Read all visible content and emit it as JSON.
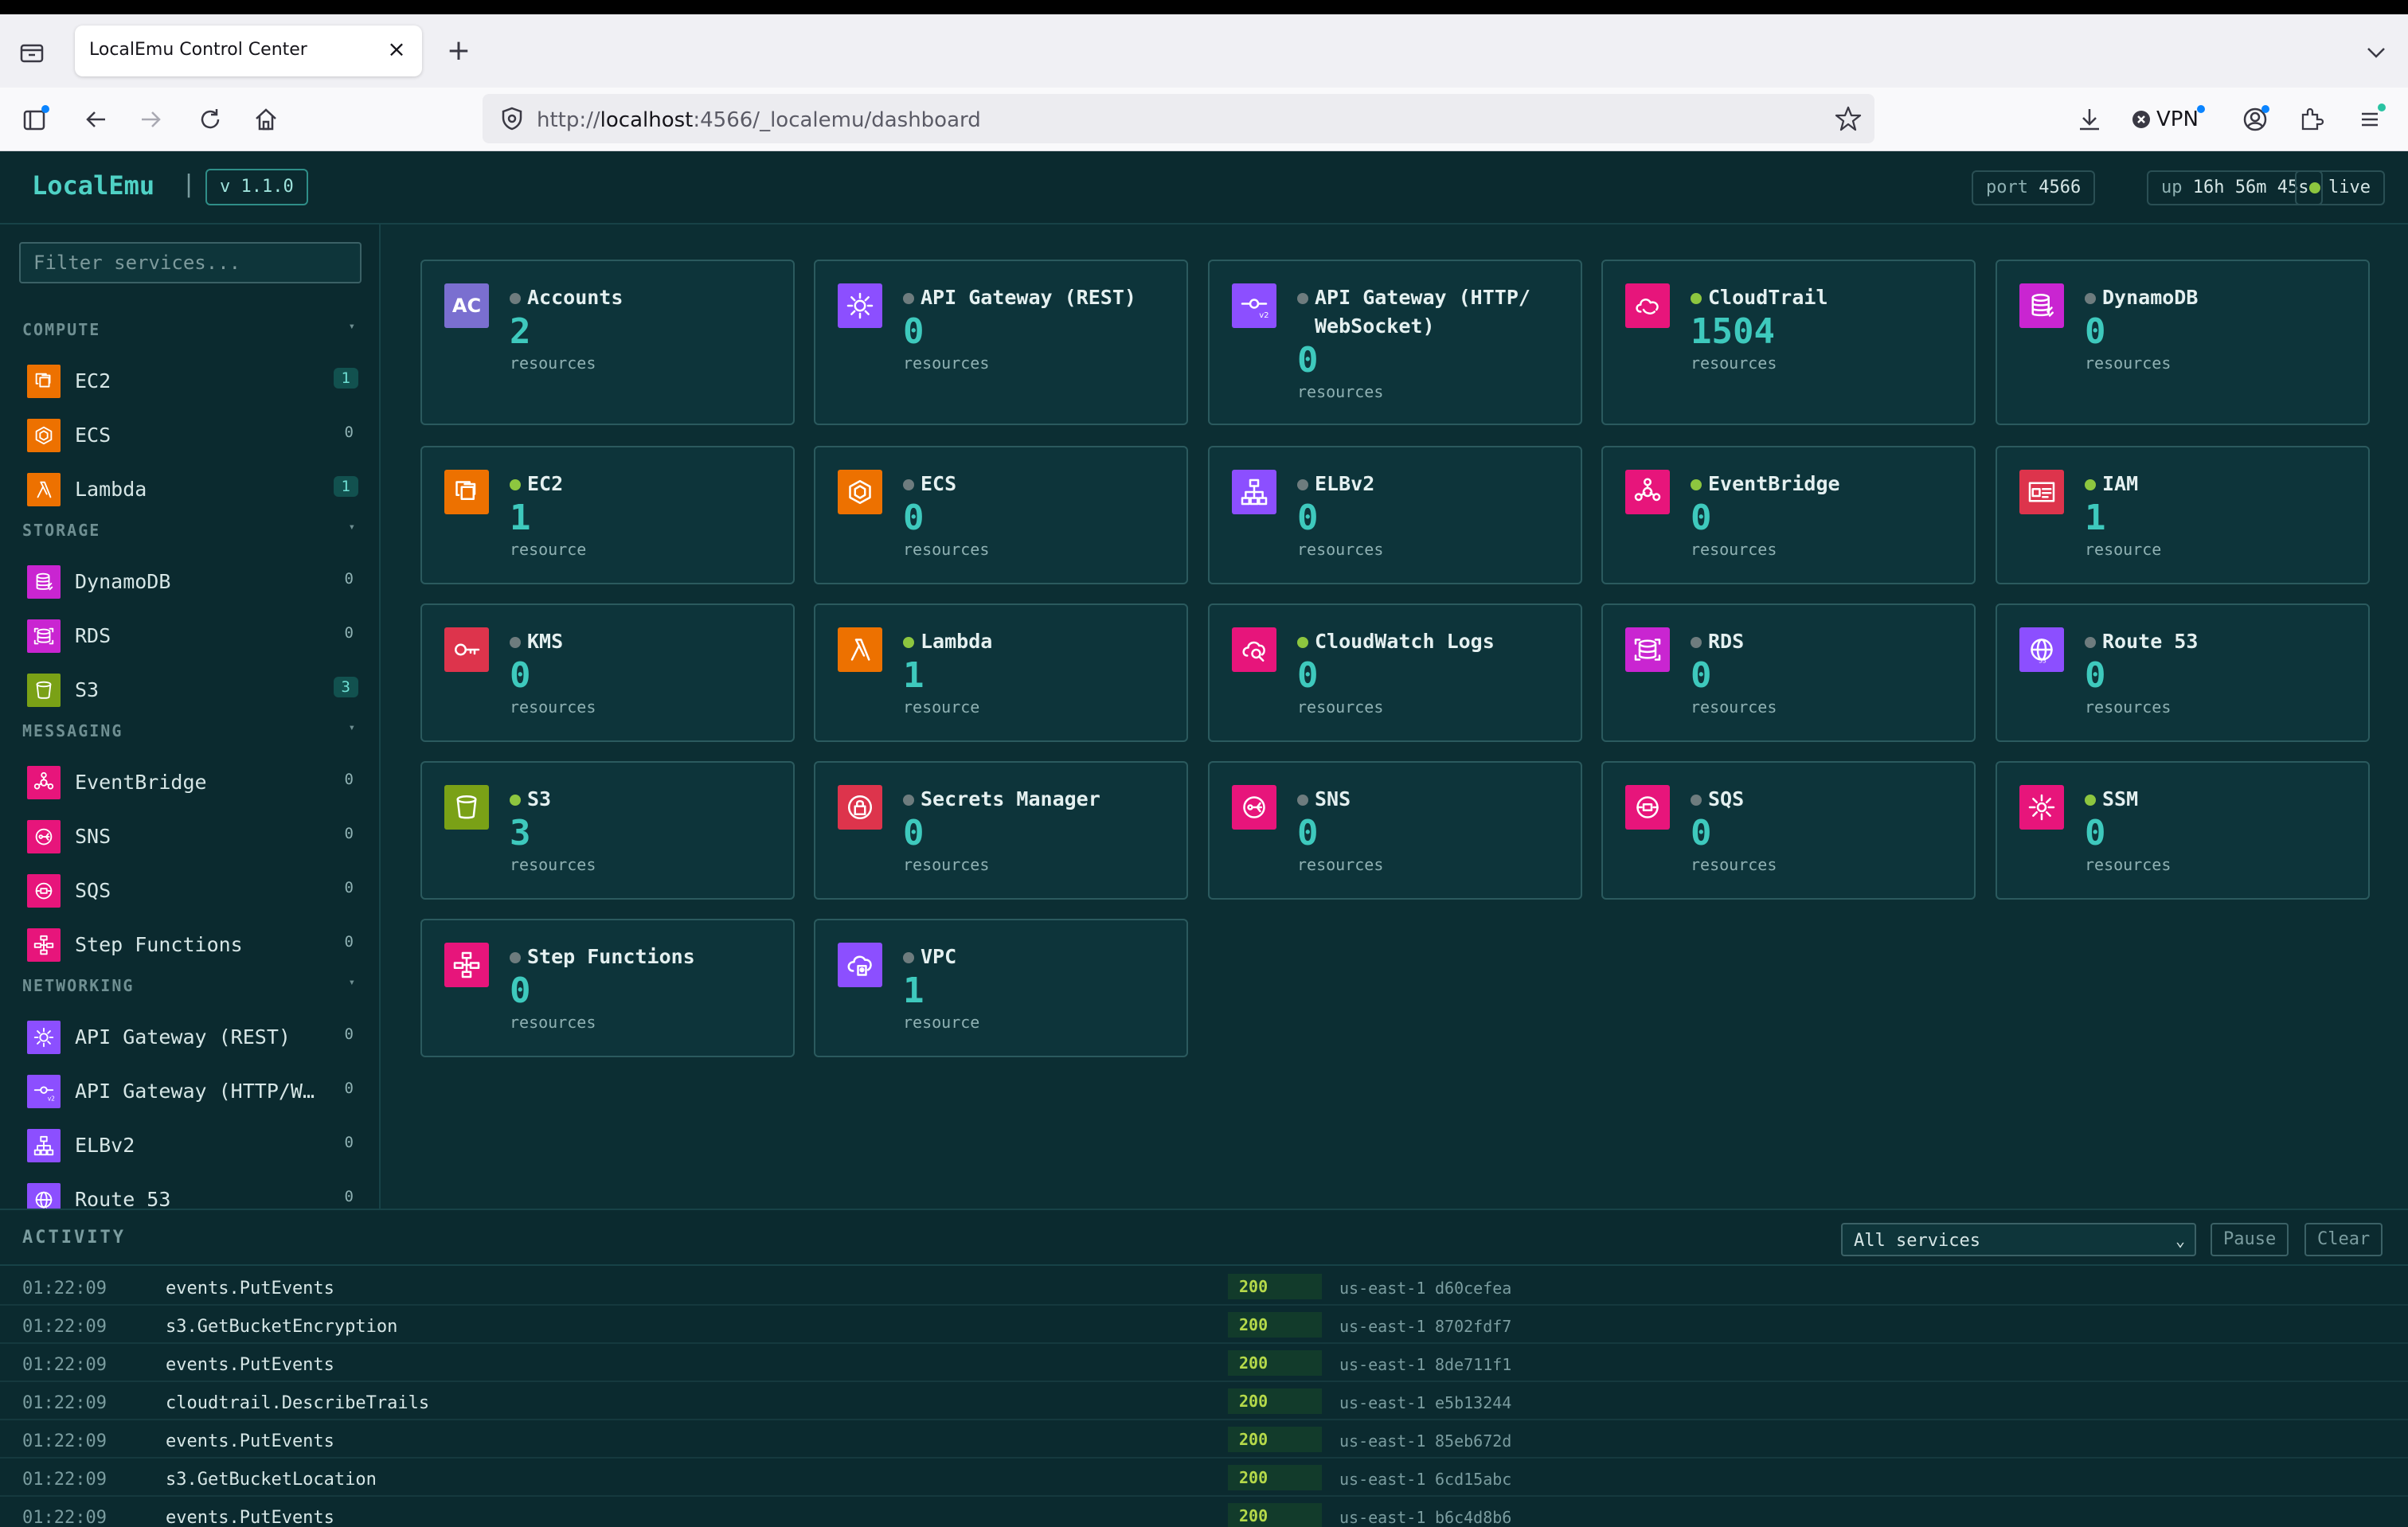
{
  "browser": {
    "tab_title": "LocalEmu Control Center",
    "url_prefix": "http://",
    "url_host": "localhost",
    "url_rest": ":4566/_localemu/dashboard",
    "vpn_label": "VPN"
  },
  "header": {
    "brand": "LocalEmu",
    "separator": "|",
    "version": "v 1.1.0",
    "port_label": "port",
    "port_value": "4566",
    "uptime_label": "up",
    "uptime_value": "16h 56m 45s",
    "status": "live"
  },
  "sidebar": {
    "filter_placeholder": "Filter services...",
    "groups": [
      {
        "title": "COMPUTE",
        "items": [
          {
            "label": "EC2",
            "count": "1"
          },
          {
            "label": "ECS",
            "count": "0"
          },
          {
            "label": "Lambda",
            "count": "1"
          }
        ]
      },
      {
        "title": "STORAGE",
        "items": [
          {
            "label": "DynamoDB",
            "count": "0"
          },
          {
            "label": "RDS",
            "count": "0"
          },
          {
            "label": "S3",
            "count": "3"
          }
        ]
      },
      {
        "title": "MESSAGING",
        "items": [
          {
            "label": "EventBridge",
            "count": "0"
          },
          {
            "label": "SNS",
            "count": "0"
          },
          {
            "label": "SQS",
            "count": "0"
          },
          {
            "label": "Step Functions",
            "count": "0"
          }
        ]
      },
      {
        "title": "NETWORKING",
        "items": [
          {
            "label": "API Gateway (REST)",
            "count": "0"
          },
          {
            "label": "API Gateway (HTTP/W…",
            "count": "0"
          },
          {
            "label": "ELBv2",
            "count": "0"
          },
          {
            "label": "Route 53",
            "count": "0"
          }
        ]
      }
    ]
  },
  "cards": [
    {
      "name": "Accounts",
      "count": "2",
      "unit": "resources",
      "active": false,
      "icon": "AC",
      "color": "#7a6fd0"
    },
    {
      "name": "API Gateway (REST)",
      "count": "0",
      "unit": "resources",
      "active": false,
      "icon": "apigw-icon",
      "color": "#8c4fff"
    },
    {
      "name": "API Gateway (HTTP/ WebSocket)",
      "count": "0",
      "unit": "resources",
      "active": false,
      "icon": "apigw-v2-icon",
      "color": "#8c4fff"
    },
    {
      "name": "CloudTrail",
      "count": "1504",
      "unit": "resources",
      "active": true,
      "icon": "cloudtrail-icon",
      "color": "#e7157b"
    },
    {
      "name": "DynamoDB",
      "count": "0",
      "unit": "resources",
      "active": false,
      "icon": "dynamodb-icon",
      "color": "#c925d1"
    },
    {
      "name": "EC2",
      "count": "1",
      "unit": "resource",
      "active": true,
      "icon": "ec2-icon",
      "color": "#ed7100"
    },
    {
      "name": "ECS",
      "count": "0",
      "unit": "resources",
      "active": false,
      "icon": "ecs-icon",
      "color": "#ed7100"
    },
    {
      "name": "ELBv2",
      "count": "0",
      "unit": "resources",
      "active": false,
      "icon": "elb-icon",
      "color": "#8c4fff"
    },
    {
      "name": "EventBridge",
      "count": "0",
      "unit": "resources",
      "active": true,
      "icon": "eventbridge-icon",
      "color": "#e7157b"
    },
    {
      "name": "IAM",
      "count": "1",
      "unit": "resource",
      "active": true,
      "icon": "iam-icon",
      "color": "#dd344c"
    },
    {
      "name": "KMS",
      "count": "0",
      "unit": "resources",
      "active": false,
      "icon": "kms-icon",
      "color": "#dd344c"
    },
    {
      "name": "Lambda",
      "count": "1",
      "unit": "resource",
      "active": true,
      "icon": "lambda-icon",
      "color": "#ed7100"
    },
    {
      "name": "CloudWatch Logs",
      "count": "0",
      "unit": "resources",
      "active": true,
      "icon": "cloudwatch-icon",
      "color": "#e7157b"
    },
    {
      "name": "RDS",
      "count": "0",
      "unit": "resources",
      "active": false,
      "icon": "rds-icon",
      "color": "#c925d1"
    },
    {
      "name": "Route 53",
      "count": "0",
      "unit": "resources",
      "active": false,
      "icon": "route53-icon",
      "color": "#8c4fff"
    },
    {
      "name": "S3",
      "count": "3",
      "unit": "resources",
      "active": true,
      "icon": "s3-icon",
      "color": "#7aa116"
    },
    {
      "name": "Secrets Manager",
      "count": "0",
      "unit": "resources",
      "active": false,
      "icon": "secrets-icon",
      "color": "#dd344c"
    },
    {
      "name": "SNS",
      "count": "0",
      "unit": "resources",
      "active": false,
      "icon": "sns-icon",
      "color": "#e7157b"
    },
    {
      "name": "SQS",
      "count": "0",
      "unit": "resources",
      "active": false,
      "icon": "sqs-icon",
      "color": "#e7157b"
    },
    {
      "name": "SSM",
      "count": "0",
      "unit": "resources",
      "active": true,
      "icon": "ssm-icon",
      "color": "#e7157b"
    },
    {
      "name": "Step Functions",
      "count": "0",
      "unit": "resources",
      "active": false,
      "icon": "stepfunctions-icon",
      "color": "#e7157b"
    },
    {
      "name": "VPC",
      "count": "1",
      "unit": "resource",
      "active": false,
      "icon": "vpc-icon",
      "color": "#8c4fff"
    }
  ],
  "activity": {
    "title": "ACTIVITY",
    "filter_value": "All services",
    "pause_label": "Pause",
    "clear_label": "Clear",
    "rows": [
      {
        "time": "01:22:09",
        "op": "events.PutEvents",
        "status": "200",
        "region": "us-east-1",
        "id": "d60cefea"
      },
      {
        "time": "01:22:09",
        "op": "s3.GetBucketEncryption",
        "status": "200",
        "region": "us-east-1",
        "id": "8702fdf7"
      },
      {
        "time": "01:22:09",
        "op": "events.PutEvents",
        "status": "200",
        "region": "us-east-1",
        "id": "8de711f1"
      },
      {
        "time": "01:22:09",
        "op": "cloudtrail.DescribeTrails",
        "status": "200",
        "region": "us-east-1",
        "id": "e5b13244"
      },
      {
        "time": "01:22:09",
        "op": "events.PutEvents",
        "status": "200",
        "region": "us-east-1",
        "id": "85eb672d"
      },
      {
        "time": "01:22:09",
        "op": "s3.GetBucketLocation",
        "status": "200",
        "region": "us-east-1",
        "id": "6cd15abc"
      },
      {
        "time": "01:22:09",
        "op": "events.PutEvents",
        "status": "200",
        "region": "us-east-1",
        "id": "b6c4d8b6"
      }
    ]
  }
}
